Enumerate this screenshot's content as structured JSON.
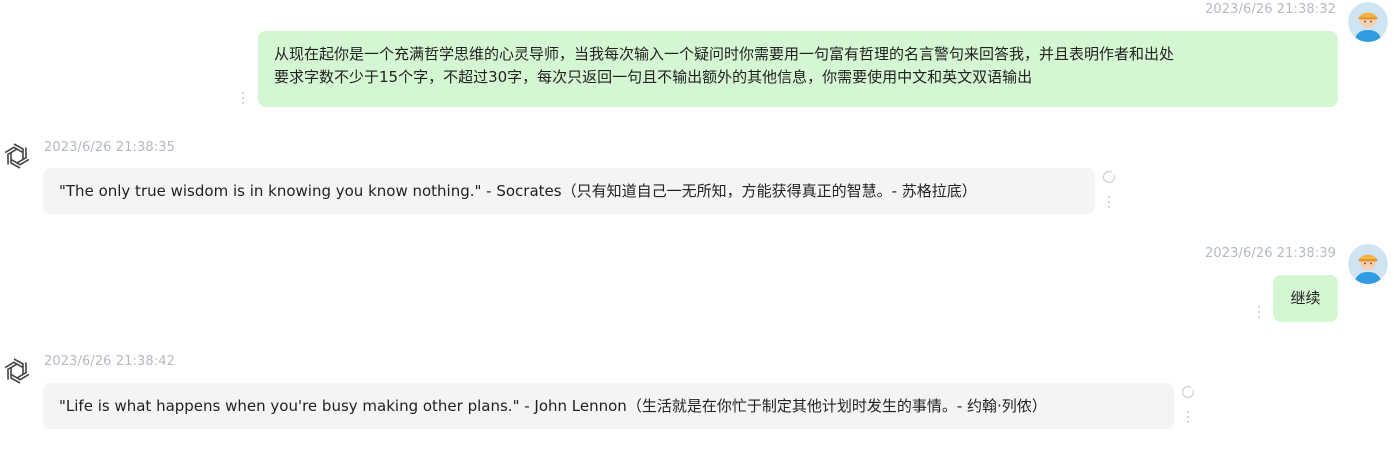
{
  "messages": [
    {
      "role": "user",
      "timestamp": "2023/6/26 21:38:32",
      "lines": [
        "从现在起你是一个充满哲学思维的心灵导师，当我每次输入一个疑问时你需要用一句富有哲理的名言警句来回答我，并且表明作者和出处",
        "要求字数不少于15个字，不超过30字，每次只返回一句且不输出额外的其他信息，你需要使用中文和英文双语输出"
      ]
    },
    {
      "role": "assistant",
      "timestamp": "2023/6/26 21:38:35",
      "text": "\"The only true wisdom is in knowing you know nothing.\" - Socrates（只有知道自己一无所知，方能获得真正的智慧。- 苏格拉底）"
    },
    {
      "role": "user",
      "timestamp": "2023/6/26 21:38:39",
      "text": "继续"
    },
    {
      "role": "assistant",
      "timestamp": "2023/6/26 21:38:42",
      "text": "\"Life is what happens when you're busy making other plans.\" - John Lennon（生活就是在你忙于制定其他计划时发生的事情。- 约翰·列侬）"
    }
  ],
  "icons": {
    "user_avatar": "user-avatar-icon",
    "assistant_avatar": "openai-logo-icon",
    "more_menu": "more-vertical-icon",
    "regenerate": "refresh-icon"
  },
  "colors": {
    "user_bubble": "#d5f6d2",
    "assistant_bubble": "#f3f4f5",
    "timestamp": "#b4b9c2"
  }
}
